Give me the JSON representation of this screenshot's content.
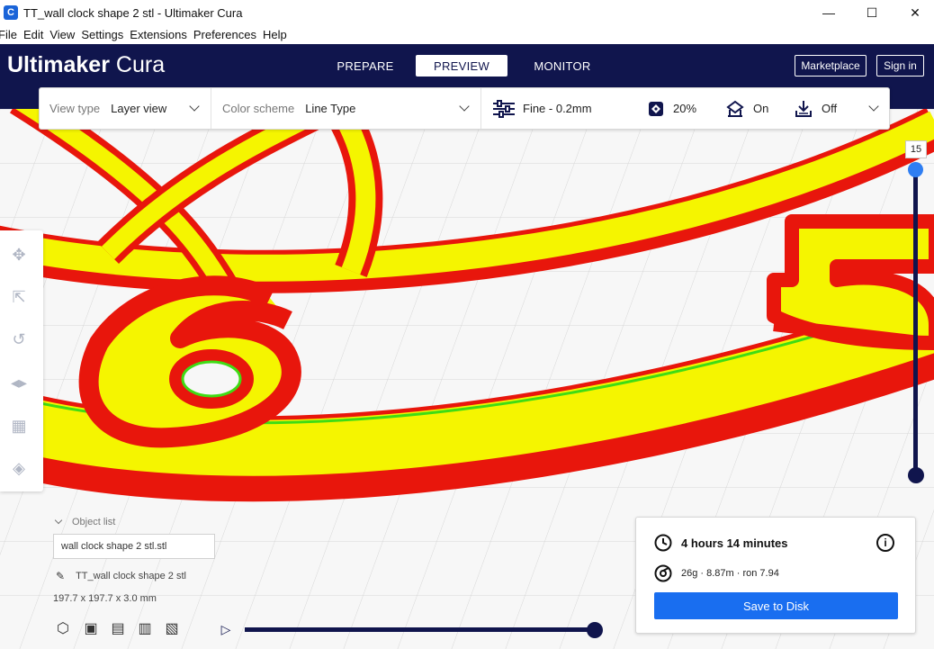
{
  "window": {
    "title": "TT_wall clock shape 2 stl - Ultimaker Cura",
    "app_icon": "cura-logo-icon",
    "controls": [
      "minimize-icon",
      "maximize-icon",
      "close-icon"
    ]
  },
  "menu": [
    "File",
    "Edit",
    "View",
    "Settings",
    "Extensions",
    "Preferences",
    "Help"
  ],
  "header": {
    "logo_brand": "Ultimaker",
    "logo_product": "Cura",
    "tabs": [
      {
        "label": "PREPARE",
        "active": false
      },
      {
        "label": "PREVIEW",
        "active": true
      },
      {
        "label": "MONITOR",
        "active": false
      }
    ],
    "marketplace_label": "Marketplace",
    "signin_label": "Sign in"
  },
  "settings_bar": {
    "view_type_label": "View type",
    "view_type_value": "Layer view",
    "color_scheme_label": "Color scheme",
    "color_scheme_value": "Line Type",
    "profile": "Fine - 0.2mm",
    "infill": "20%",
    "support": "On",
    "adhesion": "Off"
  },
  "toolbar": {
    "tools": [
      "move-icon",
      "scale-icon",
      "rotate-icon",
      "mirror-icon",
      "per-model-settings-icon",
      "support-blocker-icon"
    ]
  },
  "layer_slider": {
    "current_layer": "15"
  },
  "object_list": {
    "header": "Object list",
    "selected_file": "wall clock shape 2 stl.stl",
    "object_name": "TT_wall clock shape 2 stl",
    "dimensions": "197.7 x 197.7 x 3.0 mm",
    "view_icons": [
      "3d-view-icon",
      "front-view-icon",
      "top-view-icon",
      "left-view-icon",
      "right-view-icon"
    ]
  },
  "simulation": {
    "progress": 1.0
  },
  "print_info": {
    "time": "4 hours 14 minutes",
    "material": "26g · 8.87m · ron 7.94",
    "save_label": "Save to Disk"
  },
  "colors": {
    "header_bg": "#10154d",
    "accent_blue": "#196ef0",
    "wall_red": "#e8160c",
    "infill_yellow": "#f5f500",
    "inner_green": "#3fdc14"
  }
}
